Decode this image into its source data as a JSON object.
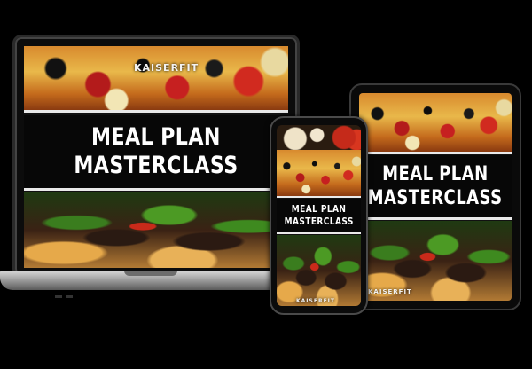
{
  "product": {
    "brand": "KAISERFIT",
    "title_line1": "MEAL PLAN",
    "title_line2": "MASTERCLASS"
  },
  "devices": [
    {
      "name": "laptop"
    },
    {
      "name": "phone"
    },
    {
      "name": "tablet"
    }
  ],
  "colors": {
    "background": "#000000",
    "title_text": "#ffffff",
    "title_band": "#070707",
    "divider": "#e9e9e9"
  },
  "icons": [
    "laptop-icon",
    "phone-icon",
    "tablet-icon"
  ]
}
